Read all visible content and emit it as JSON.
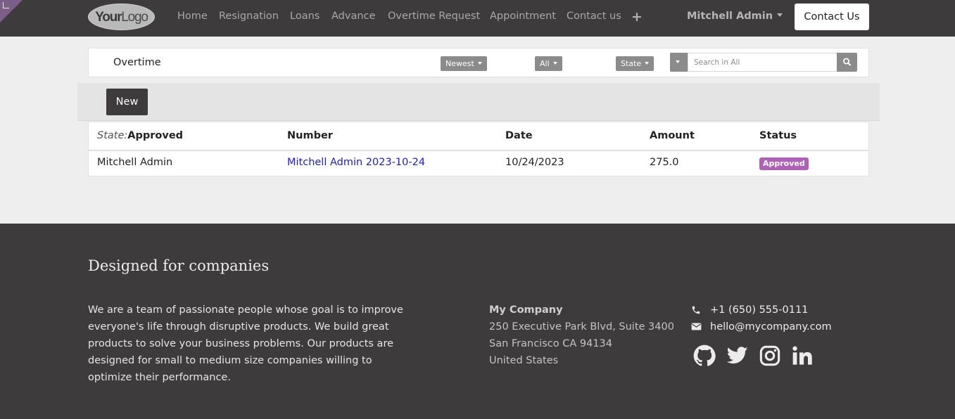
{
  "header": {
    "logo_text": {
      "bold": "Your",
      "normal": "Logo"
    },
    "nav": [
      "Home",
      "Resignation",
      "Loans",
      "Advance",
      "Overtime Request",
      "Appointment",
      "Contact us"
    ],
    "user": "Mitchell Admin",
    "contact_button": "Contact Us"
  },
  "searchbar": {
    "title": "Overtime",
    "sort": "Newest",
    "filter": "All",
    "group": "State",
    "search_placeholder": "Search in All"
  },
  "toolbar": {
    "new_label": "New"
  },
  "table": {
    "group_prefix": "State:",
    "group_value": "Approved",
    "headers": [
      "Number",
      "Date",
      "Amount",
      "Status"
    ],
    "rows": [
      {
        "employee": "Mitchell Admin",
        "number": "Mitchell Admin 2023-10-24",
        "date": "10/24/2023",
        "amount": "275.0",
        "status": "Approved"
      }
    ]
  },
  "footer": {
    "title": "Designed for companies",
    "about": "We are a team of passionate people whose goal is to improve everyone's life through disruptive products. We build great products to solve your business problems. Our products are designed for small to medium size companies willing to optimize their performance.",
    "company": {
      "name": "My Company",
      "address_lines": [
        "250 Executive Park Blvd, Suite 3400",
        "San Francisco CA 94134",
        "United States"
      ]
    },
    "phone": "+1 (650) 555-0111",
    "email": "hello@mycompany.com",
    "social_icons": [
      "github-icon",
      "twitter-icon",
      "instagram-icon",
      "linkedin-icon"
    ]
  },
  "colors": {
    "navbar_bg": "#3d3b3c",
    "badge_approved": "#b060b8",
    "link": "#1a1adc",
    "page_bg": "#efeeee"
  }
}
